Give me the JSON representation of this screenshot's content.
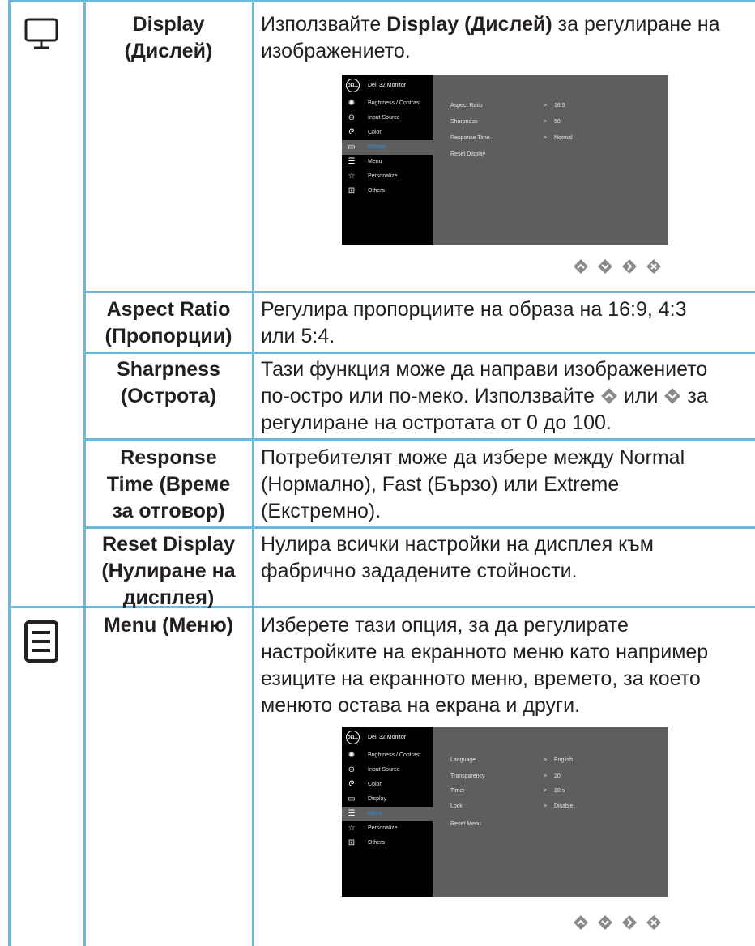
{
  "colors": {
    "table_line": "#6fb6db",
    "osd_bg": "#000000",
    "osd_panel": "#5e5e5e",
    "osd_selected": "#2f8fd6",
    "nav_icon": "#8a8a8a"
  },
  "rows": {
    "display": {
      "icon": "monitor-icon",
      "name_line1": "Display",
      "name_line2": "(Дислей)",
      "desc_prefix": "Използвайте ",
      "desc_bold": "Display (Дислей)",
      "desc_suffix": " за регулиране на",
      "desc_line2": "изображението."
    },
    "aspect_ratio": {
      "name_line1": "Aspect Ratio",
      "name_line2": "(Пропорции)",
      "desc_line1": "Регулира пропорциите на образа на 16:9, 4:3",
      "desc_line2": "или 5:4."
    },
    "sharpness": {
      "name_line1": "Sharpness",
      "name_line2": "(Острота)",
      "desc_line1": "Тази функция може да направи изображението",
      "desc_line2a": "по-остро или по-меко. Използвайте ",
      "desc_line2b": " или ",
      "desc_line2c": " за",
      "desc_line3": "регулиране на остротата от 0 до 100."
    },
    "response_time": {
      "name_line1": "Response",
      "name_line2": "Time (Време",
      "name_line3": "за отговор)",
      "desc_line1": "Потребителят може да избере между Normal",
      "desc_line2": "(Нормално), Fast (Бързо) или Extreme",
      "desc_line3": "(Екстремно)."
    },
    "reset_display": {
      "name_line1": "Reset Display",
      "name_line2": "(Нулиране на",
      "name_line3": "дисплея)",
      "desc_line1": "Нулира всички настройки на дисплея към",
      "desc_line2": "фабрично зададените стойности."
    },
    "menu": {
      "icon": "menu-list-icon",
      "name_line1": "Menu (Меню)",
      "desc_line1": "Изберете тази опция, за да регулирате",
      "desc_line2": "настройките на екранното меню като например",
      "desc_line3": "езиците на екранното меню, времето, за което",
      "desc_line4": "менюто остава на екрана и други."
    }
  },
  "osd1": {
    "logo": "DELL",
    "title": "Dell 32 Monitor",
    "menu": [
      {
        "icon": "sun-icon",
        "label": "Brightness / Contrast"
      },
      {
        "icon": "input-source-icon",
        "label": "Input Source"
      },
      {
        "icon": "color-palette-icon",
        "label": "Color"
      },
      {
        "icon": "monitor-icon",
        "label": "Display"
      },
      {
        "icon": "menu-list-icon",
        "label": "Menu"
      },
      {
        "icon": "star-icon",
        "label": "Personalize"
      },
      {
        "icon": "others-icon",
        "label": "Others"
      }
    ],
    "options": [
      {
        "label": "Aspect Ratio",
        "arrow": ">",
        "value": "16:9"
      },
      {
        "label": "Sharpness",
        "arrow": ">",
        "value": "50"
      },
      {
        "label": "Response Time",
        "arrow": ">",
        "value": "Normal"
      },
      {
        "label": "Reset Display",
        "arrow": "",
        "value": ""
      }
    ]
  },
  "osd2": {
    "logo": "DELL",
    "title": "Dell 32 Monitor",
    "menu": [
      {
        "icon": "sun-icon",
        "label": "Brightness / Contrast"
      },
      {
        "icon": "input-source-icon",
        "label": "Input Source"
      },
      {
        "icon": "color-palette-icon",
        "label": "Color"
      },
      {
        "icon": "monitor-icon",
        "label": "Display"
      },
      {
        "icon": "menu-list-icon",
        "label": "Menu"
      },
      {
        "icon": "star-icon",
        "label": "Personalize"
      },
      {
        "icon": "others-icon",
        "label": "Others"
      }
    ],
    "options": [
      {
        "label": "Language",
        "arrow": ">",
        "value": "English"
      },
      {
        "label": "Transparency",
        "arrow": ">",
        "value": "20"
      },
      {
        "label": "Timer",
        "arrow": ">",
        "value": "20 s"
      },
      {
        "label": "Lock",
        "arrow": ">",
        "value": "Disable"
      },
      {
        "label": "Reset Menu",
        "arrow": "",
        "value": ""
      }
    ]
  },
  "nav_buttons": [
    "up-button-icon",
    "down-button-icon",
    "right-button-icon",
    "close-button-icon"
  ]
}
